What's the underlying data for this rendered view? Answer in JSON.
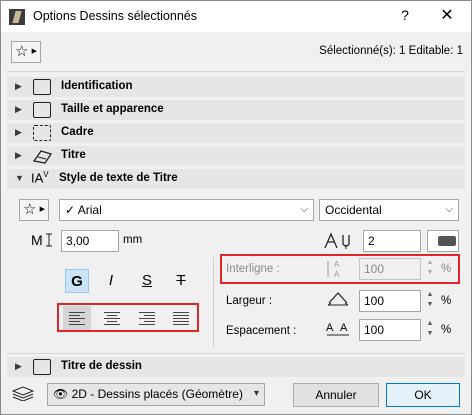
{
  "window": {
    "title": "Options Dessins sélectionnés",
    "help": "?",
    "close": "✕"
  },
  "header": {
    "selection_info": "Sélectionné(s): 1 Editable: 1"
  },
  "sections": [
    {
      "label": "Identification",
      "expanded": false
    },
    {
      "label": "Taille et apparence",
      "expanded": false
    },
    {
      "label": "Cadre",
      "expanded": false
    },
    {
      "label": "Titre",
      "expanded": false
    },
    {
      "label": "Style de texte de Titre",
      "expanded": true
    },
    {
      "label": "Titre de dessin",
      "expanded": false
    }
  ],
  "text_style": {
    "font_value": "Arial",
    "script_value": "Occidental",
    "height_value": "3,00",
    "height_unit": "mm",
    "pen_value": "2",
    "bold": "G",
    "italic": "I",
    "underline": "S",
    "strike": "T",
    "line_spacing_label": "Interligne :",
    "line_spacing_value": "100",
    "width_label": "Largeur :",
    "width_value": "100",
    "spacing_label": "Espacement :",
    "spacing_value": "100",
    "percent": "%"
  },
  "footer": {
    "view_value": "2D - Dessins placés (Géomètre)",
    "cancel": "Annuler",
    "ok": "OK"
  },
  "colors": {
    "highlight": "#e0262a",
    "section_bg": "#e6e6e6",
    "ok_border": "#0078d7"
  }
}
